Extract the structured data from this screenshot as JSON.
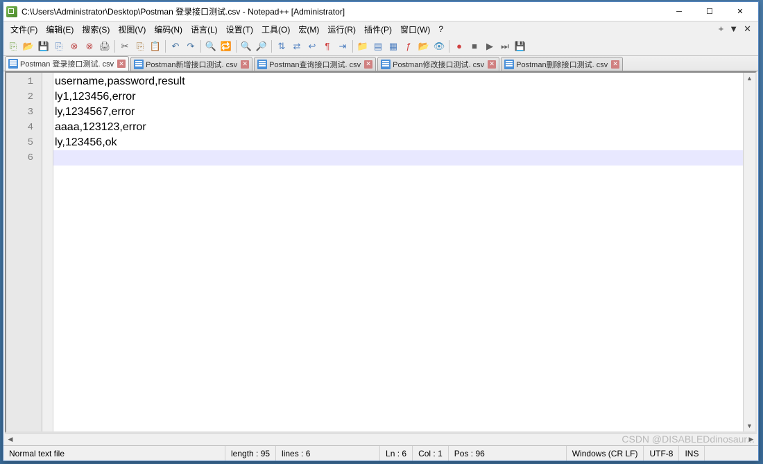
{
  "window": {
    "title": "C:\\Users\\Administrator\\Desktop\\Postman 登录接口测试.csv - Notepad++ [Administrator]"
  },
  "menu": {
    "items": [
      "文件(F)",
      "编辑(E)",
      "搜索(S)",
      "视图(V)",
      "编码(N)",
      "语言(L)",
      "设置(T)",
      "工具(O)",
      "宏(M)",
      "运行(R)",
      "插件(P)",
      "窗口(W)",
      "?"
    ]
  },
  "tabs": [
    {
      "label": "Postman 登录接口测试. csv",
      "active": true
    },
    {
      "label": "Postman新增接口测试. csv",
      "active": false
    },
    {
      "label": "Postman查询接口测试. csv",
      "active": false
    },
    {
      "label": "Postman修改接口测试. csv",
      "active": false
    },
    {
      "label": "Postman删除接口测试. csv",
      "active": false
    }
  ],
  "editor": {
    "lines": [
      "username,password,result",
      "ly1,123456,error",
      "ly,1234567,error",
      "aaaa,123123,error",
      "ly,123456,ok",
      ""
    ],
    "current_line": 6
  },
  "status": {
    "file_type": "Normal text file",
    "length": "length : 95",
    "lines": "lines : 6",
    "ln": "Ln : 6",
    "col": "Col : 1",
    "pos": "Pos : 96",
    "eol": "Windows (CR LF)",
    "encoding": "UTF-8",
    "mode": "INS"
  },
  "watermark": "CSDN @DISABLEDdinosaur..."
}
